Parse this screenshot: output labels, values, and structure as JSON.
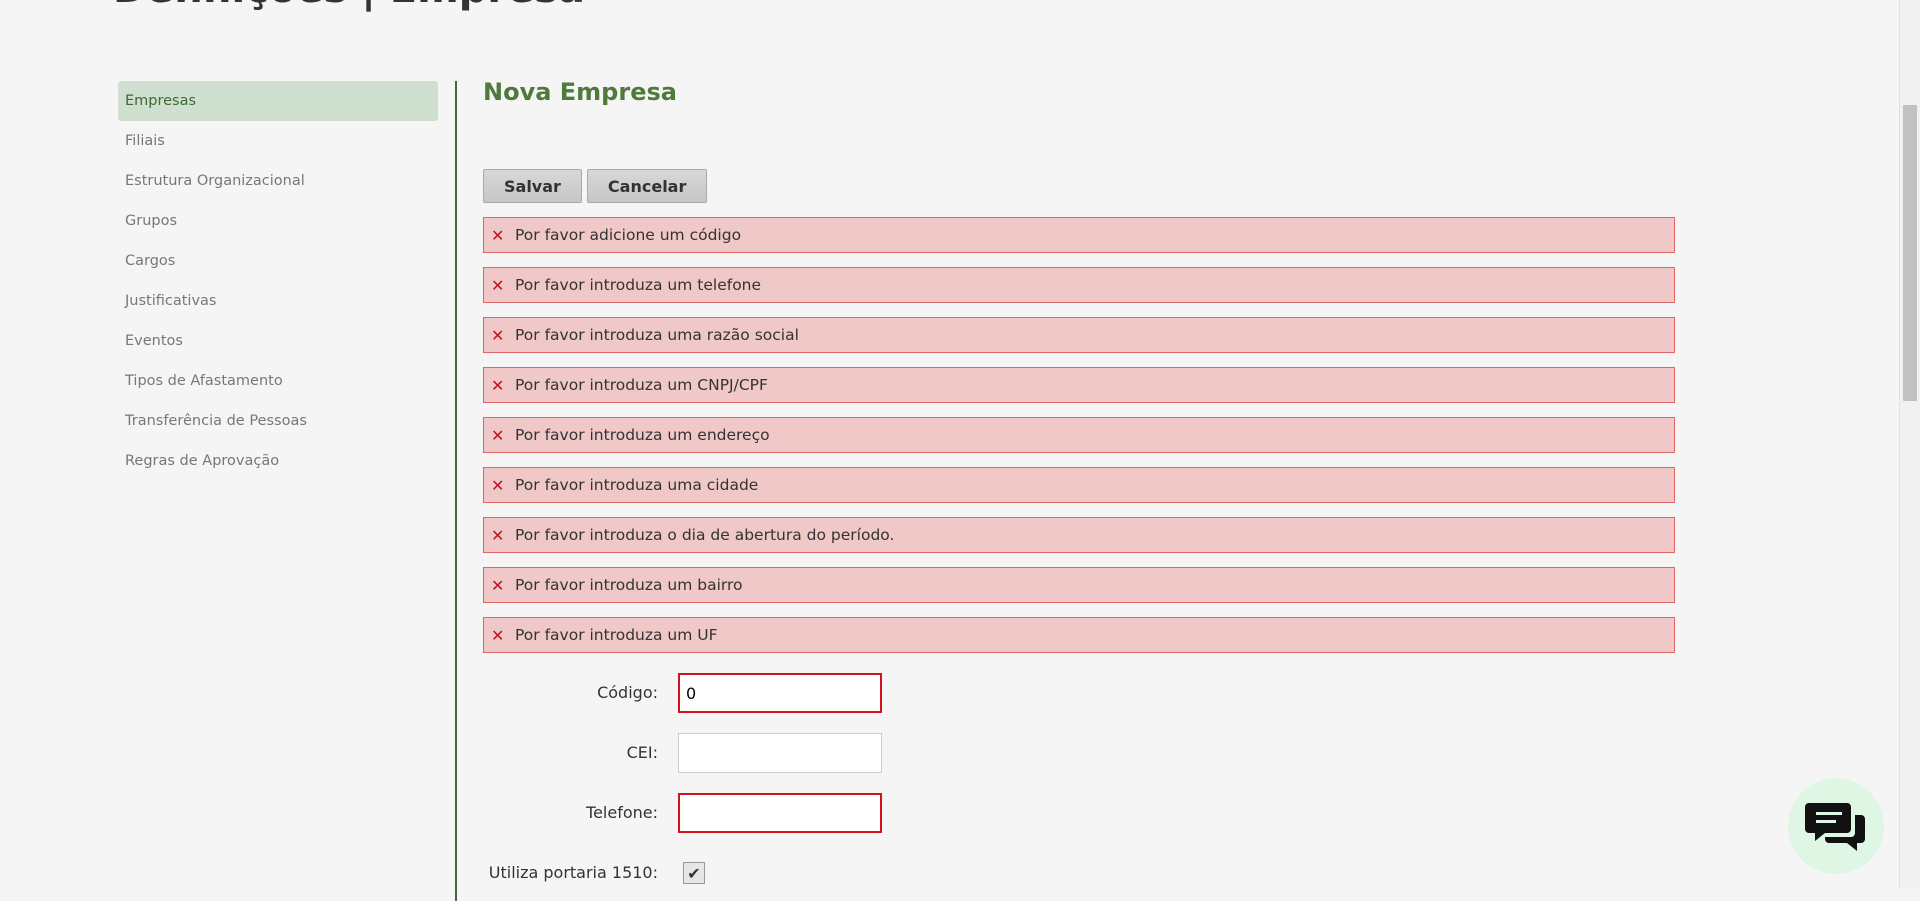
{
  "header": {
    "title": "Definições | Empresa"
  },
  "sidebar": {
    "items": [
      {
        "label": "Empresas",
        "active": true
      },
      {
        "label": "Filiais"
      },
      {
        "label": "Estrutura Organizacional"
      },
      {
        "label": "Grupos"
      },
      {
        "label": "Cargos"
      },
      {
        "label": "Justificativas"
      },
      {
        "label": "Eventos"
      },
      {
        "label": "Tipos de Afastamento"
      },
      {
        "label": "Transferência de Pessoas"
      },
      {
        "label": "Regras de Aprovação"
      }
    ]
  },
  "main": {
    "title": "Nova Empresa",
    "buttons": {
      "save": "Salvar",
      "cancel": "Cancelar"
    },
    "errors": [
      "Por favor adicione um código",
      "Por favor introduza um telefone",
      "Por favor introduza uma razão social",
      "Por favor introduza um CNPJ/CPF",
      "Por favor introduza um endereço",
      "Por favor introduza uma cidade",
      "Por favor introduza o dia de abertura do período.",
      "Por favor introduza um bairro",
      "Por favor introduza um UF"
    ],
    "form": {
      "codigo": {
        "label": "Código:",
        "value": "0"
      },
      "cei": {
        "label": "CEI:",
        "value": ""
      },
      "telefone": {
        "label": "Telefone:",
        "value": ""
      },
      "portaria": {
        "label": "Utiliza portaria 1510:",
        "checked": true
      }
    }
  },
  "colors": {
    "accent": "#4e7a3c",
    "active_bg": "#cfdfd0",
    "error_bg": "#f1c8c8",
    "error_border": "#dd6666",
    "error_icon": "#c0141e",
    "chat_bg": "#dff6e4"
  },
  "icons": {
    "error": "close-x-icon",
    "chat": "chat-bubbles-icon",
    "check": "checkmark-icon"
  }
}
